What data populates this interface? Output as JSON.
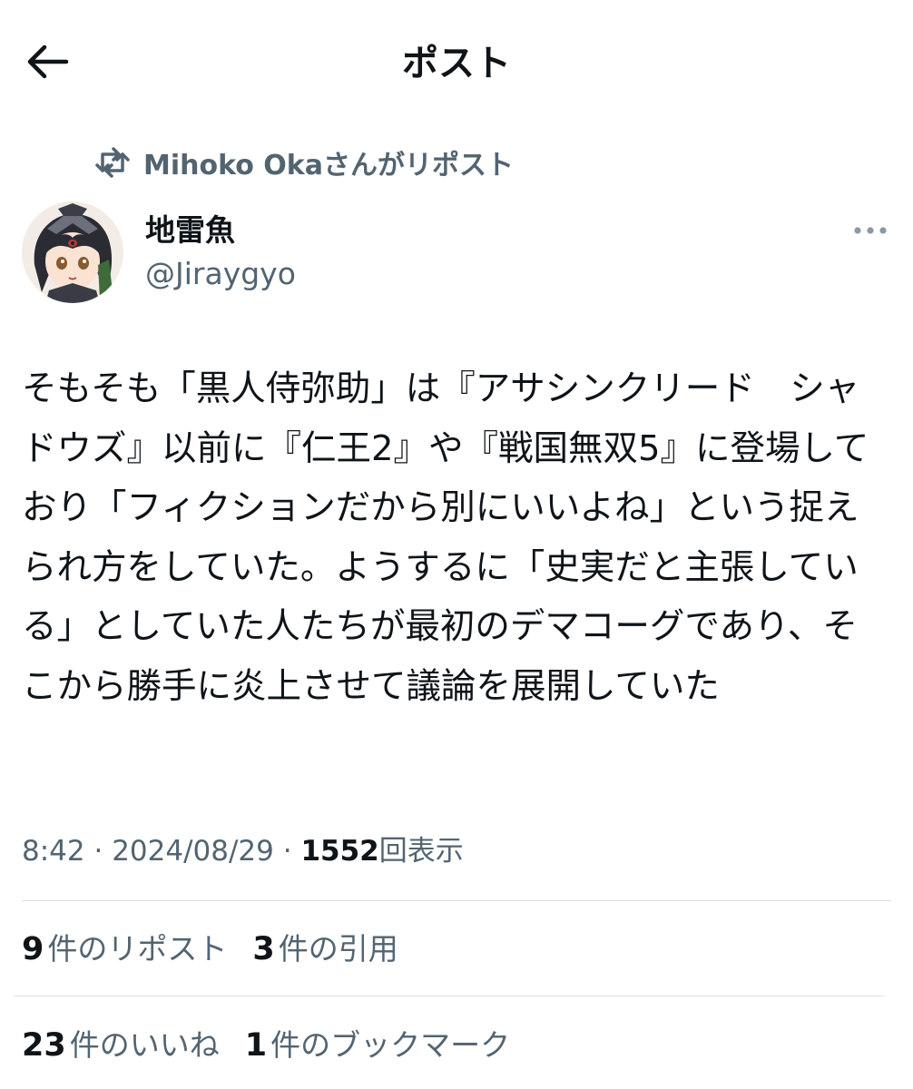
{
  "header": {
    "title": "ポスト",
    "back_icon": "arrow-left-icon"
  },
  "repost": {
    "icon": "repost-icon",
    "text": "Mihoko Okaさんがリポスト"
  },
  "author": {
    "display_name": "地雷魚",
    "handle": "@Jiraygyo",
    "more_icon": "more-horizontal-icon"
  },
  "post": {
    "text": "そもそも「黒人侍弥助」は『アサシンクリード　シャドウズ』以前に『仁王2』や『戦国無双5』に登場しており「フィクションだから別にいいよね」という捉えられ方をしていた。ようするに「史実だと主張している」としていた人たちが最初のデマコーグであり、そこから勝手に炎上させて議論を展開していた"
  },
  "meta": {
    "time": "8:42",
    "separator": "·",
    "date": "2024/08/29",
    "views_count": "1552",
    "views_label": "回表示"
  },
  "stats": {
    "reposts_count": "9",
    "reposts_label": "件のリポスト",
    "quotes_count": "3",
    "quotes_label": "件の引用",
    "likes_count": "23",
    "likes_label": "件のいいね",
    "bookmarks_count": "1",
    "bookmarks_label": "件のブックマーク"
  },
  "colors": {
    "text_primary": "#0f1419",
    "text_secondary": "#536471",
    "divider": "#dcdfe2",
    "background": "#ffffff"
  }
}
